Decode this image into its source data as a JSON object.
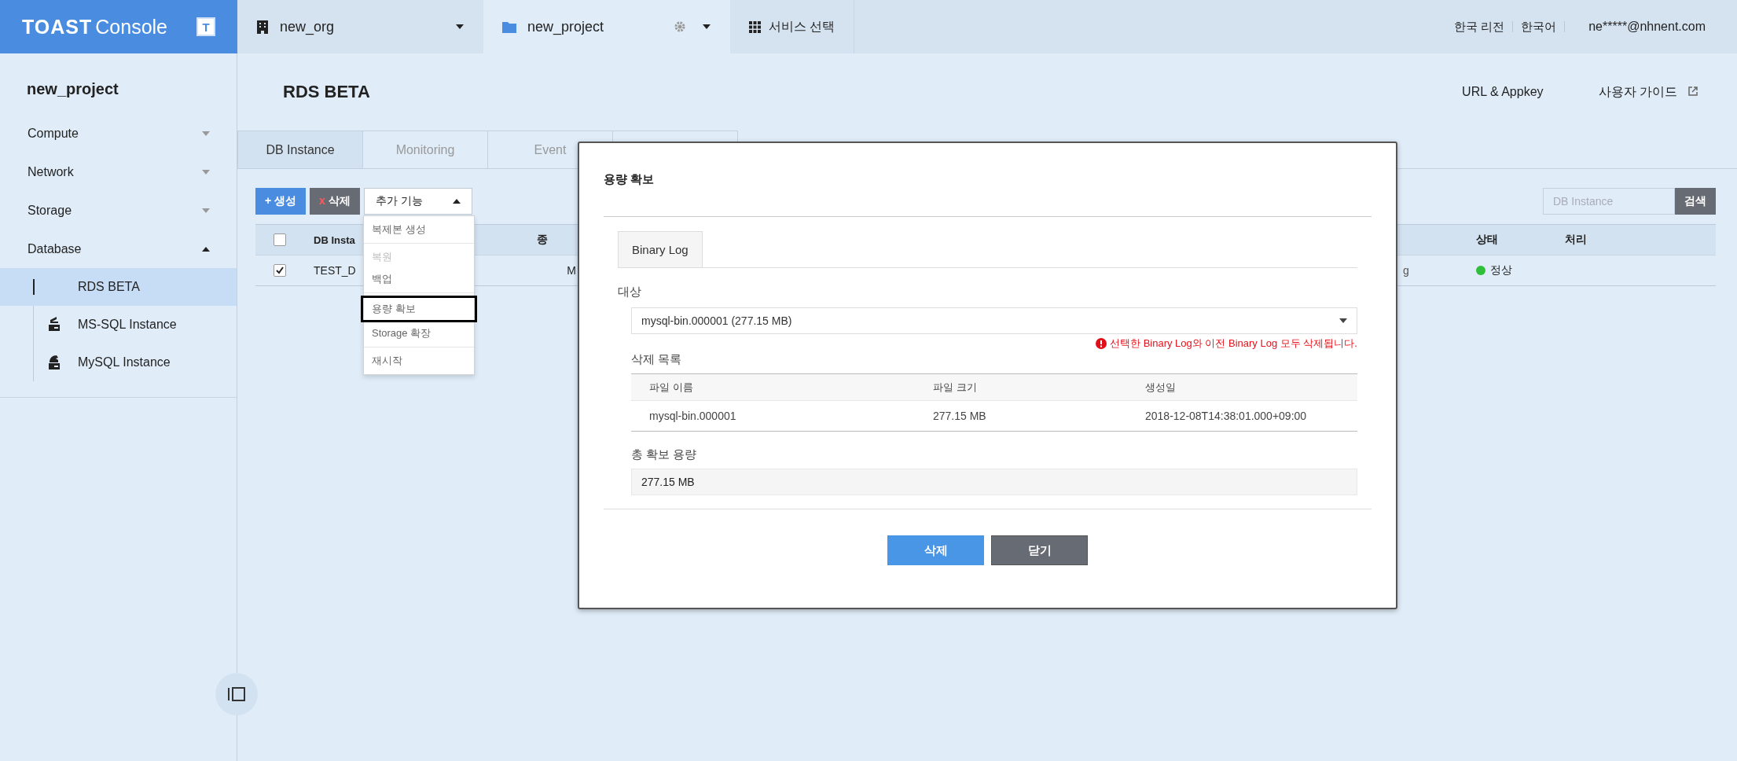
{
  "header": {
    "logo": "TOAST",
    "logo_suffix": "Console",
    "logo_badge": "T",
    "org": "new_org",
    "project": "new_project",
    "services": "서비스 선택",
    "region": "한국 리전",
    "language": "한국어",
    "user": "ne*****@nhnent.com"
  },
  "sidebar": {
    "project": "new_project",
    "items": [
      {
        "label": "Compute",
        "expanded": false
      },
      {
        "label": "Network",
        "expanded": false
      },
      {
        "label": "Storage",
        "expanded": false
      },
      {
        "label": "Database",
        "expanded": true,
        "children": [
          {
            "label": "RDS BETA",
            "selected": true,
            "kind": "service"
          },
          {
            "label": "MS-SQL Instance",
            "selected": false,
            "kind": "mssql"
          },
          {
            "label": "MySQL Instance",
            "selected": false,
            "kind": "mysql"
          }
        ]
      }
    ]
  },
  "page": {
    "title": "RDS BETA",
    "links": [
      {
        "label": "URL & Appkey",
        "external": false
      },
      {
        "label": "사용자 가이드",
        "external": true
      }
    ]
  },
  "tabs": [
    {
      "label": "DB Instance",
      "selected": true
    },
    {
      "label": "Monitoring",
      "selected": false
    },
    {
      "label": "Event",
      "selected": false
    }
  ],
  "toolbar": {
    "create": "+ 생성",
    "delete_mark": "x",
    "delete": "삭제",
    "more": "추가 기능",
    "search_placeholder": "DB Instance",
    "search_button": "검색"
  },
  "menu": {
    "groups": [
      [
        {
          "label": "복제본 생성",
          "disabled": false,
          "highlighted": false
        }
      ],
      [
        {
          "label": "복원",
          "disabled": true,
          "highlighted": false
        },
        {
          "label": "백업",
          "disabled": false,
          "highlighted": false
        }
      ],
      [
        {
          "label": "용량 확보",
          "disabled": false,
          "highlighted": true
        },
        {
          "label": "Storage 확장",
          "disabled": false,
          "highlighted": false
        }
      ],
      [
        {
          "label": "재시작",
          "disabled": false,
          "highlighted": false
        }
      ]
    ]
  },
  "table": {
    "header_checked": false,
    "column_1": "DB Insta",
    "column_2": "종",
    "status": "상태",
    "action": "처리",
    "rows": [
      {
        "checked": true,
        "column_1": "TEST_D",
        "column_2": "M",
        "column_3": "g",
        "status": "정상",
        "color": "#2fbf3a"
      }
    ]
  },
  "modal": {
    "title": "용량 확보",
    "tabs": [
      {
        "label": "Binary Log",
        "selected": true
      }
    ],
    "target_label": "대상",
    "target_value": "mysql-bin.000001 (277.15 MB)",
    "warning": "선택한 Binary Log와 이전 Binary Log 모두 삭제됩니다.",
    "list_label": "삭제 목록",
    "columns": [
      "파일 이름",
      "파일 크기",
      "생성일"
    ],
    "rows": [
      [
        "mysql-bin.000001",
        "277.15 MB",
        "2018-12-08T14:38:01.000+09:00"
      ]
    ],
    "total_label": "총 확보 용량",
    "total_value": "277.15 MB",
    "buttons": [
      {
        "label": "삭제",
        "kind": "primary"
      },
      {
        "label": "닫기",
        "kind": "secondary"
      }
    ]
  }
}
